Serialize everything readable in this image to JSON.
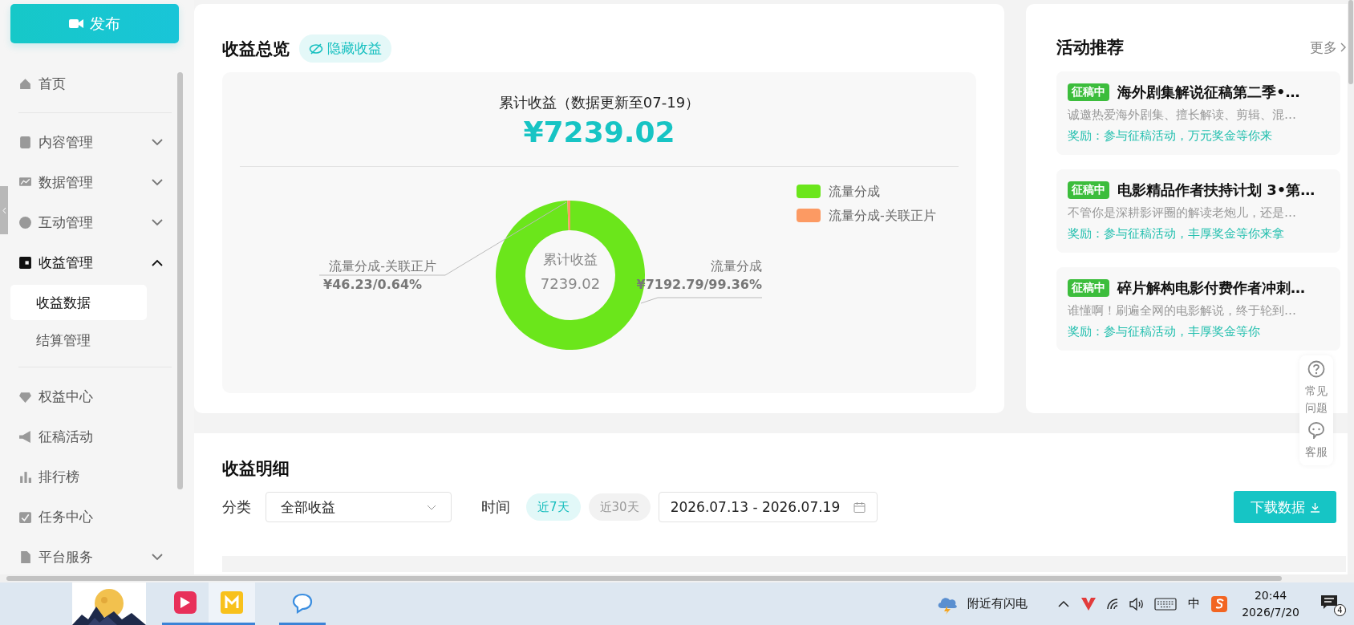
{
  "sidebar": {
    "publish_button": "发布",
    "sections": [
      {
        "items": [
          {
            "label": "首页",
            "selected": false
          }
        ]
      },
      {
        "items": [
          {
            "label": "内容管理",
            "selected": false,
            "expanded": false
          },
          {
            "label": "数据管理",
            "selected": false,
            "expanded": false
          },
          {
            "label": "互动管理",
            "selected": false,
            "expanded": false
          },
          {
            "label": "收益管理",
            "selected": true,
            "expanded": true,
            "children": [
              {
                "label": "收益数据",
                "selected": true
              },
              {
                "label": "结算管理",
                "selected": false
              }
            ]
          }
        ]
      },
      {
        "items": [
          {
            "label": "权益中心",
            "selected": false
          },
          {
            "label": "征稿活动",
            "selected": false
          },
          {
            "label": "排行榜",
            "selected": false
          },
          {
            "label": "任务中心",
            "selected": false
          },
          {
            "label": "平台服务",
            "selected": false,
            "expanded": false
          }
        ]
      }
    ]
  },
  "overview": {
    "title": "收益总览",
    "hide_button": "隐藏收益",
    "summary_label": "累计收益（数据更新至07-19）",
    "total": "¥7239.02",
    "center_label": "累计收益",
    "center_value": "7239.02",
    "legend": [
      {
        "color": "#6be61b"
      },
      {
        "color": "#fc9a63"
      }
    ],
    "callouts": [
      "流量分成-关联正片",
      "流量分成"
    ],
    "chart_data": {
      "type": "donut",
      "legend": "top-right",
      "categories": [
        "流量分成",
        "流量分成-关联正片"
      ],
      "values": [
        99.36,
        0.64
      ],
      "value_labels": [
        "¥7192.79/99.36%",
        "¥46.23/0.64%"
      ]
    }
  },
  "activities": {
    "title": "活动推荐",
    "more": "更多",
    "items": [
      {
        "badge": "征稿中",
        "title": "海外剧集解说征稿第二季•…",
        "description": "诚邀热爱海外剧集、擅长解读、剪辑、混…",
        "reward": "奖励：参与征稿活动，万元奖金等你来"
      },
      {
        "badge": "征稿中",
        "title": "电影精品作者扶持计划 3•第…",
        "description": "不管你是深耕影评圈的解读老炮儿，还是…",
        "reward": "奖励：参与征稿活动，丰厚奖金等你来拿"
      },
      {
        "badge": "征稿中",
        "title": "碎片解构电影付费作者冲刺…",
        "description": "谁懂啊！刷遍全网的电影解说，终于轮到…",
        "reward": "奖励：参与征稿活动，丰厚奖金等你"
      }
    ]
  },
  "help_widget": {
    "items": [
      {
        "kind": "faq",
        "label": "常见问题"
      },
      {
        "kind": "service",
        "label": "客服"
      }
    ]
  },
  "details": {
    "title": "收益明细",
    "category_label": "分类",
    "category_select": "全部收益",
    "time_label": "时间",
    "ranges": [
      {
        "label": "近7天",
        "selected": true
      },
      {
        "label": "近30天",
        "selected": false
      }
    ],
    "date_range": "2026.07.13 - 2026.07.19",
    "download_button": "下载数据"
  },
  "taskbar": {
    "apps": [
      {
        "selected": false
      },
      {
        "selected": true
      },
      {
        "selected": false
      }
    ],
    "weather": "附近有闪电",
    "ime": "中",
    "time": "20:44",
    "date": "2026/7/20",
    "notifications": "4"
  }
}
